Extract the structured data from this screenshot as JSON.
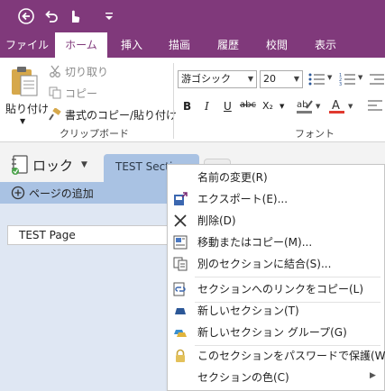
{
  "tabs": [
    "ファイル",
    "ホーム",
    "挿入",
    "描画",
    "履歴",
    "校閲",
    "表示"
  ],
  "ribbon": {
    "paste_label": "貼り付け",
    "cut_label": "切り取り",
    "copy_label": "コピー",
    "format_painter_label": "書式のコピー/貼り付け",
    "clipboard_group": "クリップボード",
    "font_name": "游ゴシック",
    "font_size": "20",
    "font_group": "フォント",
    "bold": "B",
    "italic": "I",
    "underline": "U",
    "strike": "abc",
    "subscript": "X₂"
  },
  "notebook": {
    "name": "ロック",
    "section_tab": "TEST Section",
    "add_page": "ページの追加",
    "page_title": "TEST  Page"
  },
  "context_menu": {
    "items": [
      {
        "label": "名前の変更(R)",
        "icon": "rename-icon"
      },
      {
        "label": "エクスポート(E)...",
        "icon": "export-icon"
      },
      {
        "label": "削除(D)",
        "icon": "delete-icon"
      },
      {
        "label": "移動またはコピー(M)...",
        "icon": "move-copy-icon"
      },
      {
        "label": "別のセクションに結合(S)...",
        "icon": "merge-icon"
      },
      {
        "label": "セクションへのリンクをコピー(L)",
        "icon": "link-icon"
      },
      {
        "label": "新しいセクション(T)",
        "icon": "new-section-icon"
      },
      {
        "label": "新しいセクション グループ(G)",
        "icon": "new-section-group-icon"
      },
      {
        "label": "このセクションをパスワードで保護(W)...",
        "icon": "lock-icon"
      },
      {
        "label": "セクションの色(C)",
        "icon": "submenu-arrow-icon"
      }
    ]
  },
  "colors": {
    "brand": "#80397b",
    "section_tab": "#a9c2e3",
    "page_area": "#dfe7f3"
  }
}
